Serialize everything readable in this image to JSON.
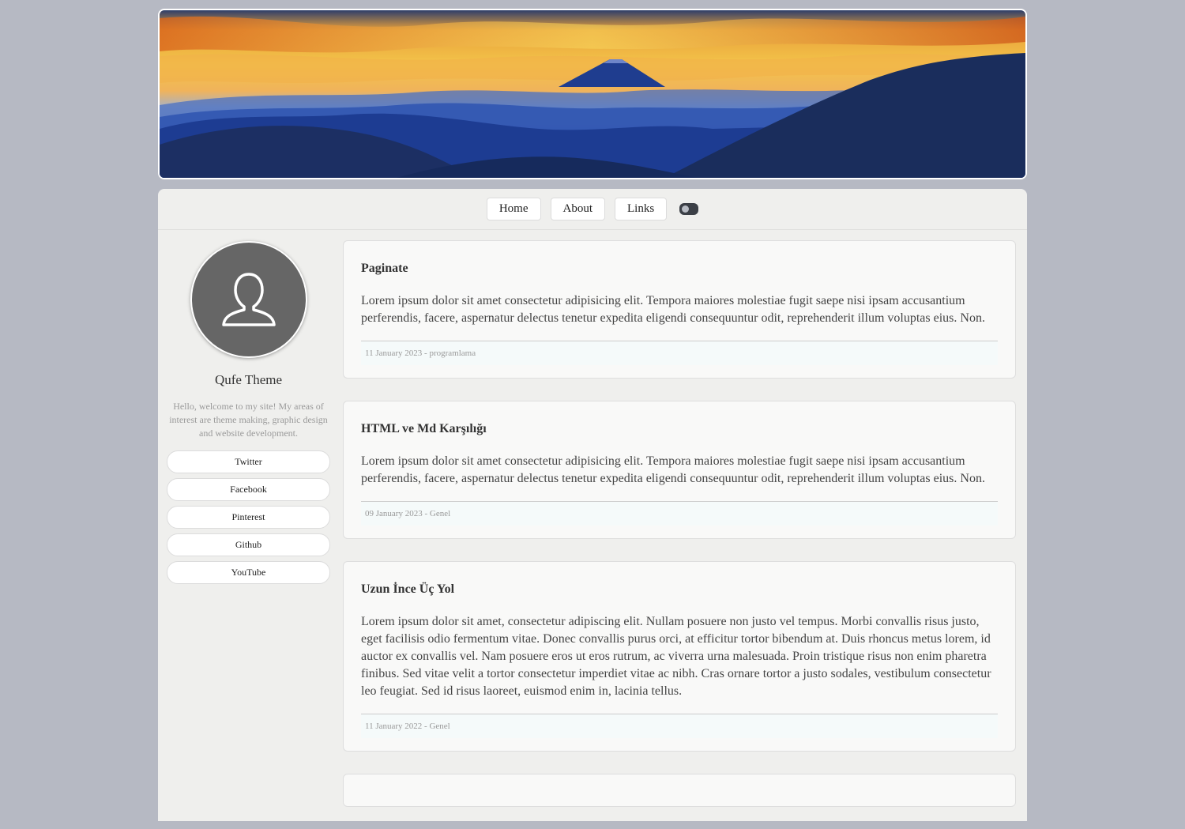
{
  "nav": {
    "items": [
      "Home",
      "About",
      "Links"
    ]
  },
  "sidebar": {
    "title": "Qufe Theme",
    "description": "Hello, welcome to my site! My areas of interest are theme making, graphic design and website development.",
    "social": [
      "Twitter",
      "Facebook",
      "Pinterest",
      "Github",
      "YouTube"
    ]
  },
  "posts": [
    {
      "title": "Paginate",
      "body": "Lorem ipsum dolor sit amet consectetur adipisicing elit. Tempora maiores molestiae fugit saepe nisi ipsam accusantium perferendis, facere, aspernatur delectus tenetur expedita eligendi consequuntur odit, reprehenderit illum voluptas eius. Non.",
      "meta": "11 January 2023 - programlama"
    },
    {
      "title": "HTML ve Md Karşılığı",
      "body": "Lorem ipsum dolor sit amet consectetur adipisicing elit. Tempora maiores molestiae fugit saepe nisi ipsam accusantium perferendis, facere, aspernatur delectus tenetur expedita eligendi consequuntur odit, reprehenderit illum voluptas eius. Non.",
      "meta": "09 January 2023 - Genel"
    },
    {
      "title": "Uzun İnce Üç Yol",
      "body": "Lorem ipsum dolor sit amet, consectetur adipiscing elit. Nullam posuere non justo vel tempus. Morbi convallis risus justo, eget facilisis odio fermentum vitae. Donec convallis purus orci, at efficitur tortor bibendum at. Duis rhoncus metus lorem, id auctor ex convallis vel. Nam posuere eros ut eros rutrum, ac viverra urna malesuada. Proin tristique risus non enim pharetra finibus. Sed vitae velit a tortor consectetur imperdiet vitae ac nibh. Cras ornare tortor a justo sodales, vestibulum consectetur leo feugiat. Sed id risus laoreet, euismod enim in, lacinia tellus.",
      "meta": "11 January 2022 - Genel"
    }
  ],
  "icons": {
    "avatar": "user-silhouette-icon",
    "theme_toggle": "theme-toggle-icon"
  },
  "colors": {
    "page_bg": "#b6b9c3",
    "panel_bg": "#efefed",
    "card_bg": "#f9f9f8",
    "avatar_bg": "#666666"
  }
}
